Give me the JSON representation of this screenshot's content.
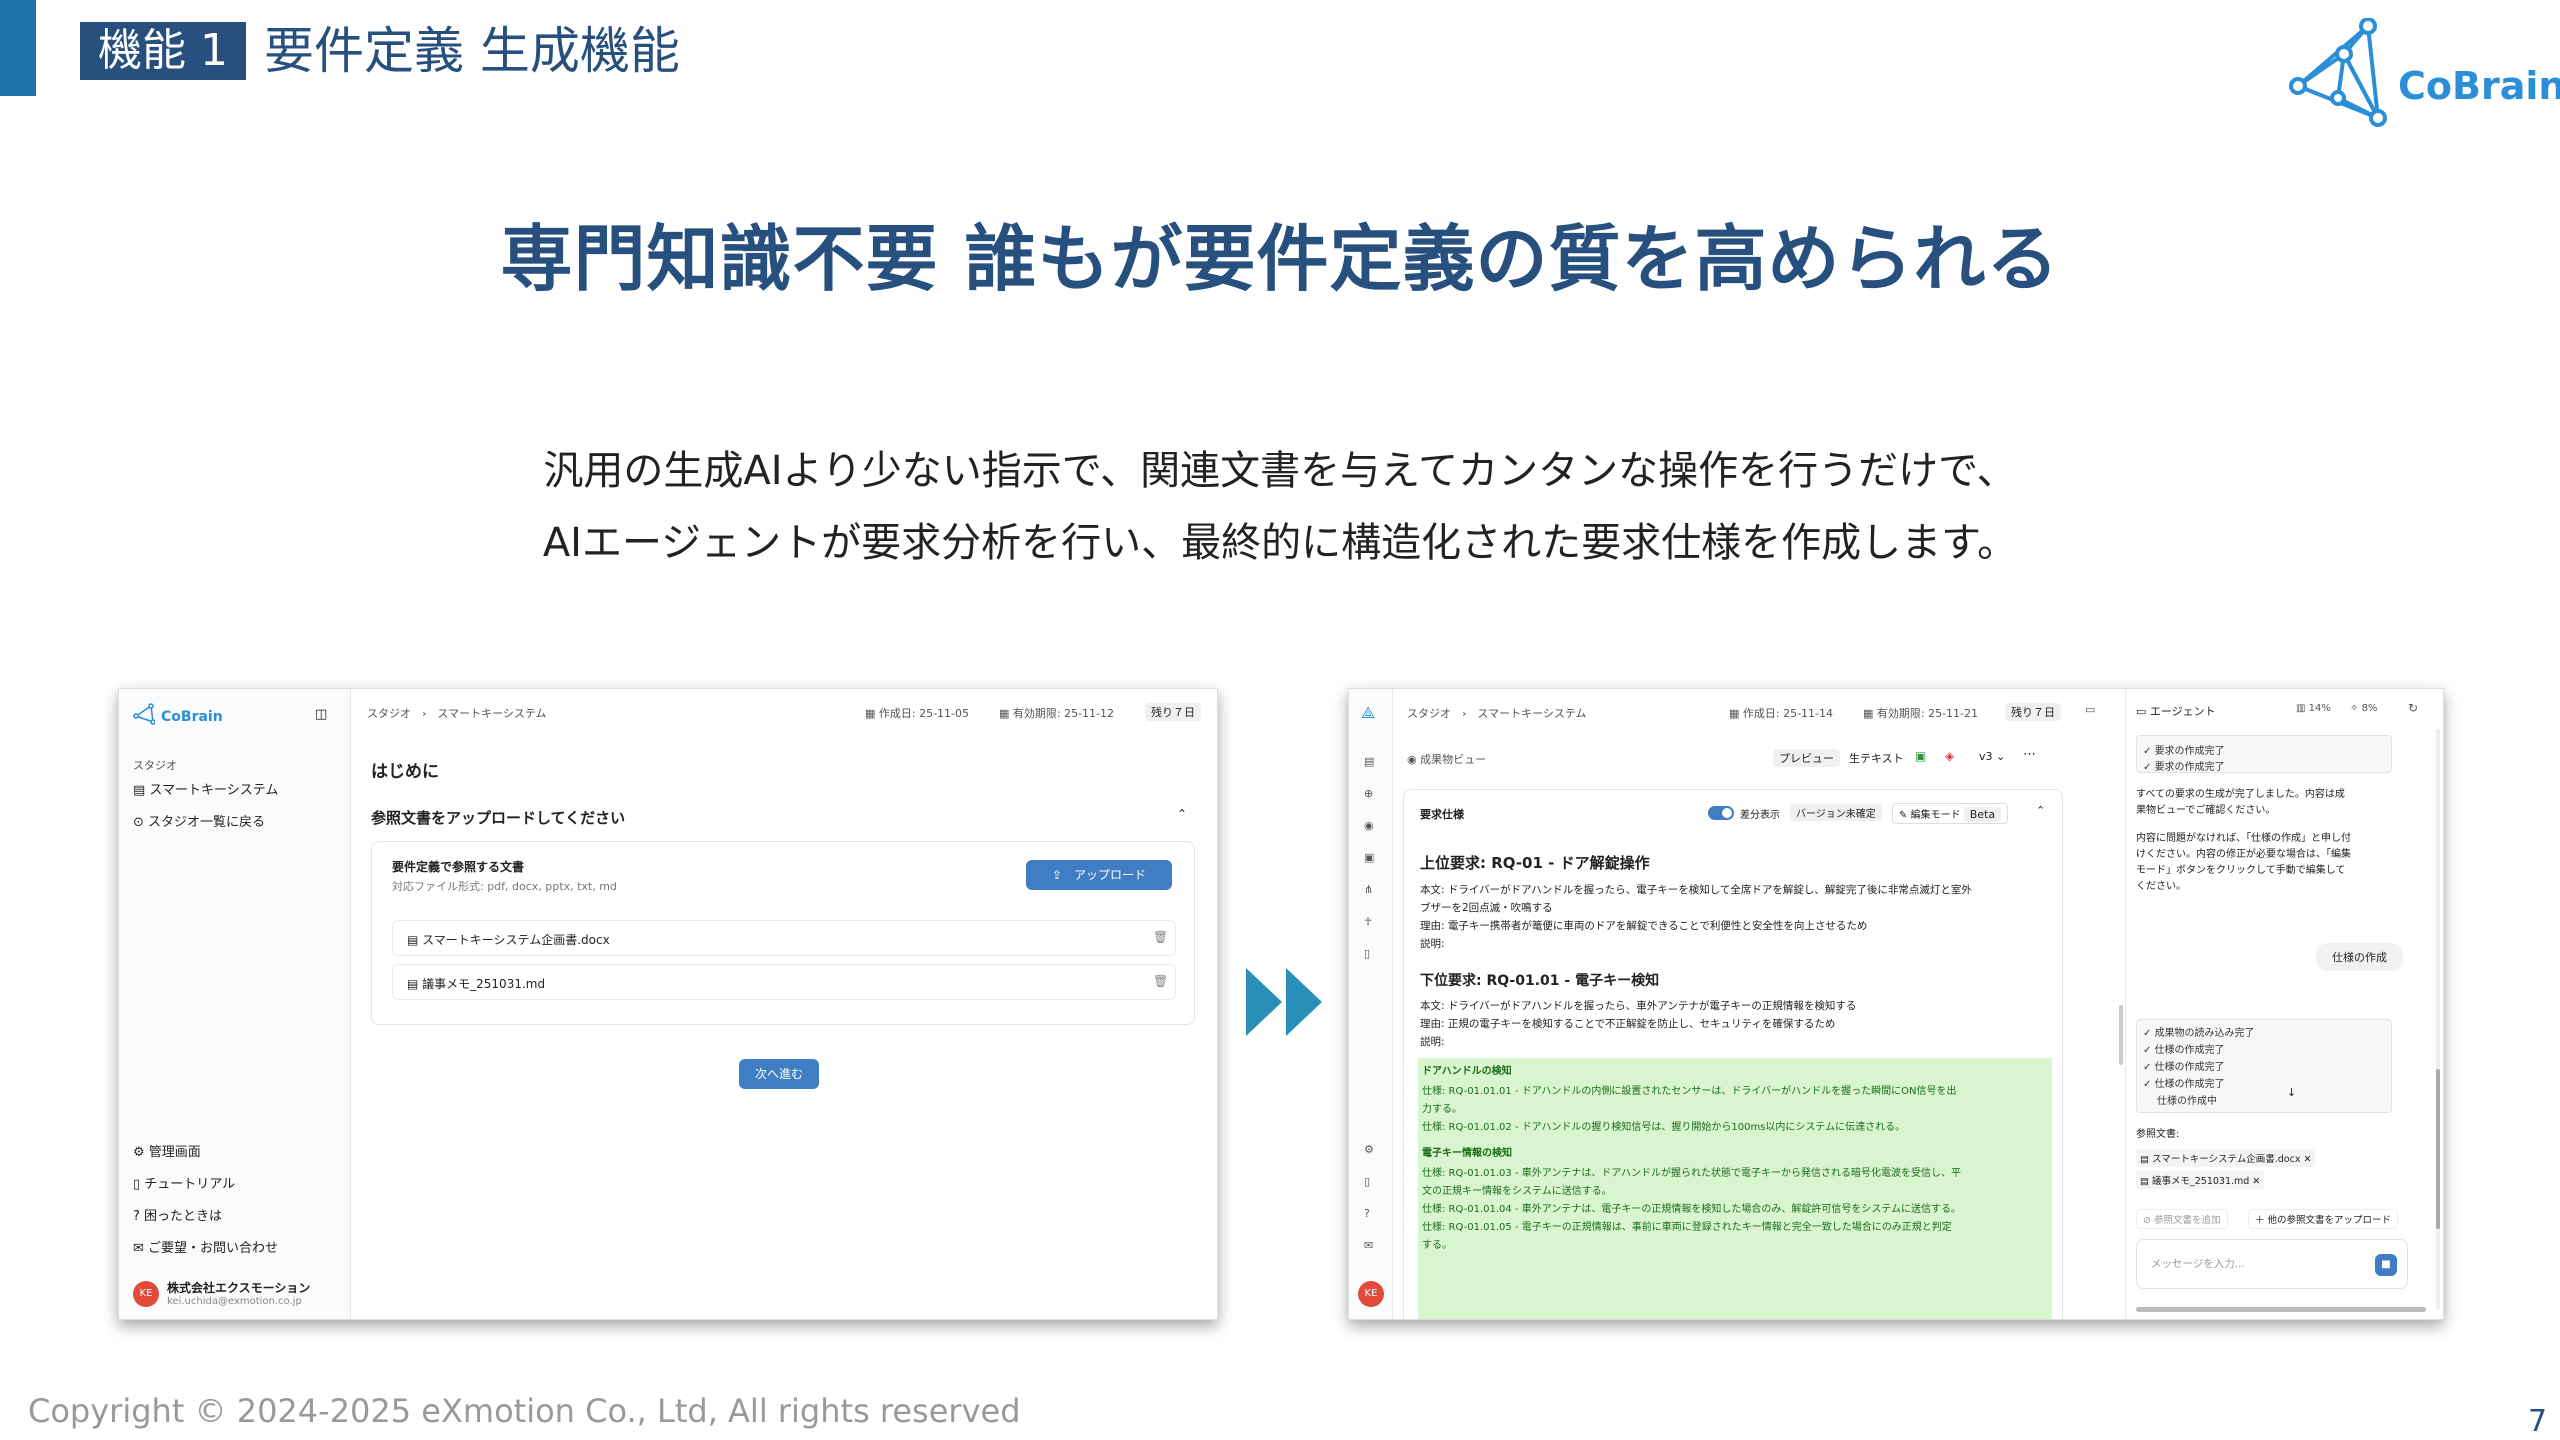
{
  "header": {
    "tag": "機能 1",
    "title": "要件定義 生成機能",
    "logo_text": "CoBrain"
  },
  "headline": "専門知識不要 誰もが要件定義の質を高められる",
  "subtext": [
    "汎用の生成AIより少ない指示で、関連文書を与えてカンタンな操作を行うだけで、",
    "AIエージェントが要求分析を行い、最終的に構造化された要求仕様を作成します。"
  ],
  "footer": {
    "copyright": "Copyright © 2024-2025 eXmotion Co., Ltd, All rights reserved",
    "page": "7"
  },
  "colors": {
    "accent": "#1f73a8",
    "brand": "#27507e",
    "button": "#3f7ec2",
    "highlight": "#d8f5cf"
  },
  "shot1": {
    "logo": "CoBrain",
    "side_section": "スタジオ",
    "side_items": [
      "スマートキーシステム",
      "スタジオ一覧に戻る"
    ],
    "side_bottom": [
      "管理画面",
      "チュートリアル",
      "困ったときは",
      "ご要望・お問い合わせ"
    ],
    "user": {
      "initials": "KE",
      "company": "株式会社エクスモーション",
      "email": "kei.uchida@exmotion.co.jp"
    },
    "breadcrumb": [
      "スタジオ",
      "スマートキーシステム"
    ],
    "meta": {
      "created": "作成日: 25-11-05",
      "expires": "有効期限: 25-11-12",
      "remaining": "残り７日"
    },
    "heading": "はじめに",
    "upload_title": "参照文書をアップロードしてください",
    "card_title": "要件定義で参照する文書",
    "card_formats": "対応ファイル形式: pdf, docx, pptx, txt, md",
    "upload_button": "アップロード",
    "files": [
      "スマートキーシステム企画書.docx",
      "議事メモ_251031.md"
    ],
    "next_button": "次へ進む"
  },
  "shot2": {
    "breadcrumb": [
      "スタジオ",
      "スマートキーシステム"
    ],
    "meta": {
      "created": "作成日: 25-11-14",
      "expires": "有効期限: 25-11-21",
      "remaining": "残り７日"
    },
    "view_label": "成果物ビュー",
    "toolbar": {
      "preview": "プレビュー",
      "raw": "生テキスト",
      "version": "v3"
    },
    "spec_label": "要求仕様",
    "diff_label": "差分表示",
    "version_status": "バージョン未確定",
    "edit_mode": "編集モード",
    "beta": "Beta",
    "req1_title": "上位要求: RQ-01 - ドア解錠操作",
    "req1_lines": [
      "本文: ドライバーがドアハンドルを握ったら、電子キーを検知して全席ドアを解錠し、解錠完了後に非常点滅灯と室外",
      "ブザーを2回点滅・吹鳴する",
      "理由: 電子キー携帯者が篭便に車両のドアを解錠できることで利便性と安全性を向上させるため",
      "説明:"
    ],
    "req2_title": "下位要求: RQ-01.01 - 電子キー検知",
    "req2_lines": [
      "本文: ドライバーがドアハンドルを握ったら、車外アンテナが電子キーの正規情報を検知する",
      "理由: 正規の電子キーを検知することで不正解錠を防止し、セキュリティを確保するため",
      "説明:"
    ],
    "green_lines": [
      "ドアハンドルの検知",
      "仕様: RQ-01.01.01 - ドアハンドルの内側に設置されたセンサーは、ドライバーがハンドルを握った瞬間にON信号を出",
      "力する。",
      "仕様: RQ-01.01.02 - ドアハンドルの握り検知信号は、握り開始から100ms以内にシステムに伝達される。",
      "電子キー情報の検知",
      "仕様: RQ-01.01.03 - 車外アンテナは、ドアハンドルが握られた状態で電子キーから発信される暗号化電波を受信し、平",
      "文の正規キー情報をシステムに送信する。",
      "仕様: RQ-01.01.04 - 車外アンテナは、電子キーの正規情報を検知した場合のみ、解錠許可信号をシステムに送信する。",
      "仕様: RQ-01.01.05 - 電子キーの正規情報は、事前に車両に登録されたキー情報と完全一致した場合にのみ正規と判定",
      "する。"
    ],
    "agent": {
      "title": "エージェント",
      "usage1": "14%",
      "usage2": "8%",
      "top_checks": [
        "要求の作成完了",
        "要求の作成完了"
      ],
      "message": [
        "すべての要求の生成が完了しました。内容は成",
        "果物ビューでご確認ください。",
        "",
        "内容に問題がなければ、「仕様の作成」と申し付",
        "けください。内容の修正が必要な場合は、「編集",
        "モード」ボタンをクリックして手動で編集して",
        "ください。"
      ],
      "user_bubble": "仕様の作成",
      "checks": [
        "成果物の読み込み完了",
        "仕様の作成完了",
        "仕様の作成完了",
        "仕様の作成完了",
        "仕様の作成中"
      ],
      "ref_label": "参照文書:",
      "refs": [
        "スマートキーシステム企画書.docx",
        "議事メモ_251031.md"
      ],
      "add_ref": "参照文書を追加",
      "upload_other": "＋ 他の参照文書をアップロード",
      "input_placeholder": "メッセージを入力..."
    },
    "user_initials": "KE"
  }
}
